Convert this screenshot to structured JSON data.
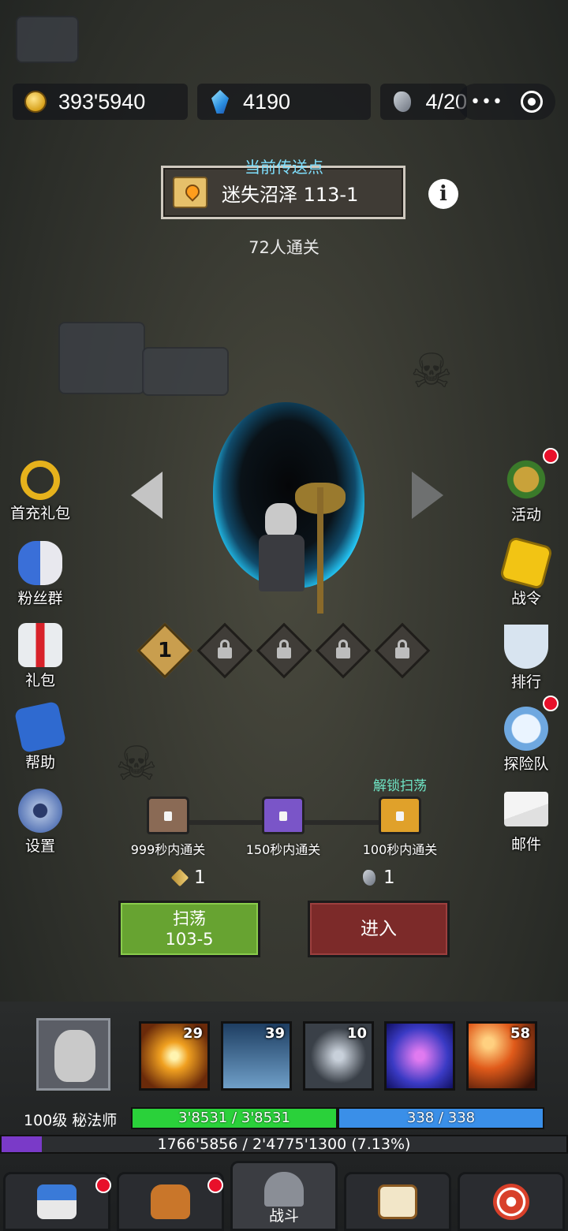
{
  "resources": {
    "gold": "393'5940",
    "gems": "4190",
    "stamina": "4/20"
  },
  "capsule": {
    "more_icon": "more-dots-icon",
    "close_icon": "target-icon"
  },
  "teleport": {
    "title": "当前传送点",
    "name": "迷失沼泽 113-1",
    "cleared": "72人通关"
  },
  "stages": [
    {
      "label": "1",
      "locked": false
    },
    {
      "label": "",
      "locked": true
    },
    {
      "label": "",
      "locked": true
    },
    {
      "label": "",
      "locked": true
    },
    {
      "label": "",
      "locked": true
    }
  ],
  "left_menu": [
    {
      "label": "首充礼包",
      "icon": "gold-ring-icon"
    },
    {
      "label": "粉丝群",
      "icon": "fans-group-icon"
    },
    {
      "label": "礼包",
      "icon": "gift-box-icon"
    },
    {
      "label": "帮助",
      "icon": "help-book-icon"
    },
    {
      "label": "设置",
      "icon": "gear-icon"
    }
  ],
  "right_menu": [
    {
      "label": "活动",
      "icon": "helmet-laurel-icon",
      "badge": true
    },
    {
      "label": "战令",
      "icon": "gold-star-icon",
      "badge": false
    },
    {
      "label": "排行",
      "icon": "trophy-icon",
      "badge": false
    },
    {
      "label": "探险队",
      "icon": "alarm-clock-icon",
      "badge": true
    },
    {
      "label": "邮件",
      "icon": "mail-icon",
      "badge": false
    }
  ],
  "chests": [
    {
      "label": "999秒内通关",
      "color": "#8a6a55"
    },
    {
      "label": "150秒内通关",
      "color": "#7a55c8"
    },
    {
      "label": "100秒内通关",
      "color": "#e0a12a"
    }
  ],
  "unlock_sweep": "解锁扫荡",
  "costs": {
    "key": "1",
    "stone": "1"
  },
  "buttons": {
    "sweep_label": "扫荡",
    "sweep_stage": "103-5",
    "enter_label": "进入"
  },
  "skills": [
    {
      "level": "29",
      "icon": "light-burst-skill-icon",
      "color": "#b8621a"
    },
    {
      "level": "39",
      "icon": "spirit-twins-skill-icon",
      "color": "#2f5a86"
    },
    {
      "level": "10",
      "icon": "vortex-skill-icon",
      "color": "#59606a"
    },
    {
      "level": "",
      "icon": "arcane-circle-skill-icon",
      "color": "#3b3ac4"
    },
    {
      "level": "58",
      "icon": "meteor-skill-icon",
      "color": "#c24a1a"
    }
  ],
  "character": {
    "level_class": "100级 秘法师",
    "hp": "3'8531 / 3'8531",
    "mp": "338 / 338",
    "exp": "1766'5856 / 2'4775'1300 (7.13%)",
    "exp_fraction": 0.0713
  },
  "bottom_nav": [
    {
      "label": "",
      "icon": "shop-stall-icon",
      "badge": true,
      "active": false
    },
    {
      "label": "",
      "icon": "backpack-icon",
      "badge": true,
      "active": false
    },
    {
      "label": "战斗",
      "icon": "dungeon-gate-icon",
      "badge": false,
      "active": true
    },
    {
      "label": "",
      "icon": "spell-book-icon",
      "badge": false,
      "active": false
    },
    {
      "label": "",
      "icon": "target-dart-icon",
      "badge": false,
      "active": false
    }
  ]
}
